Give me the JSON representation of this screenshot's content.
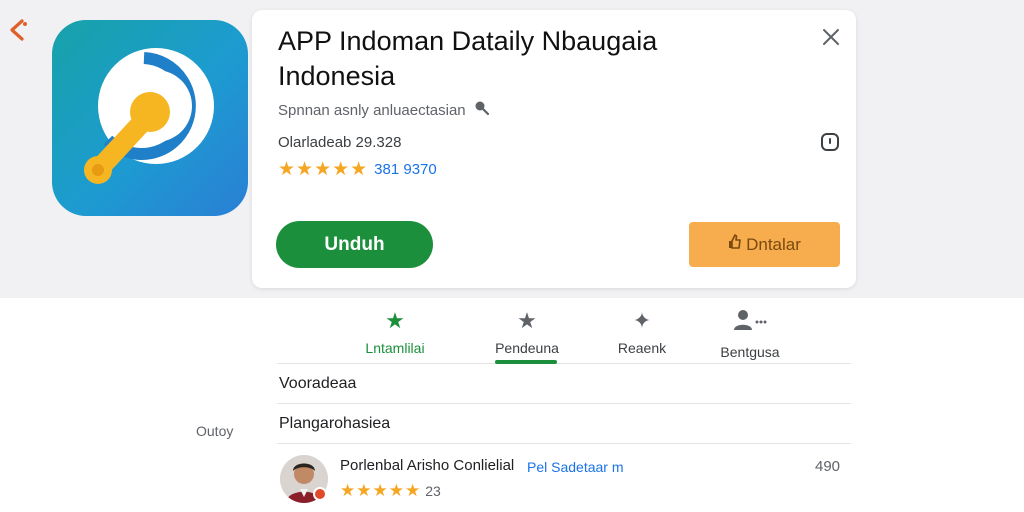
{
  "header": {
    "app_title": "APP Indoman Dataily Nbaugaia Indonesia",
    "developer": "Spnnan asnly anluaectasian",
    "downloads": "Olarladeab 29.328",
    "rating_stars": "★★★★★",
    "rating_count": "381 9370",
    "primary_button": "Unduh",
    "secondary_button": "Dntalar",
    "icons": {
      "back": "back-arrow-icon",
      "close": "close-icon",
      "info": "info-icon",
      "developer_badge": "key-icon",
      "secondary": "thumb-icon"
    }
  },
  "tabs": [
    {
      "label": "Lntamlilai",
      "icon": "★"
    },
    {
      "label": "Pendeuna",
      "icon": "★"
    },
    {
      "label": "Reaenk",
      "icon": "✦"
    },
    {
      "label": "Bentgusa",
      "icon": "👤"
    }
  ],
  "sections": {
    "row1": "Vooradeaa",
    "row2": "Plangarohasiea"
  },
  "side_label": "Outoy",
  "review": {
    "name": "Porlenbal Arisho Conlielial",
    "link": "Pel Sadetaar m",
    "count": "490",
    "stars": "★★★★★",
    "score": "23"
  },
  "colors": {
    "brand_green": "#1c8f3c",
    "accent_orange": "#f7ad4d",
    "star_yellow": "#f5a623",
    "link_blue": "#1a73e8"
  }
}
